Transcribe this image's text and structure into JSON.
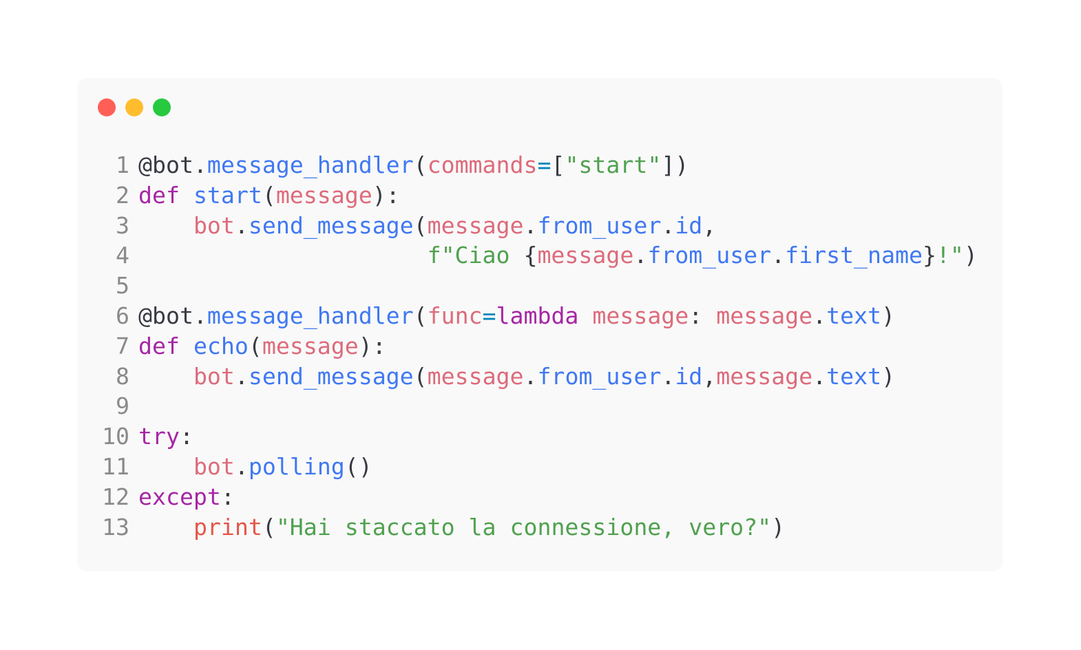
{
  "window": {
    "dots": [
      {
        "name": "close-dot",
        "color": "#ff5f56"
      },
      {
        "name": "minimize-dot",
        "color": "#ffbd2e"
      },
      {
        "name": "maximize-dot",
        "color": "#27c93f"
      }
    ]
  },
  "colors": {
    "background": "#f9f9f9",
    "keyword": "#a626a4",
    "function": "#4078f2",
    "variable": "#dd6b7b",
    "builtin": "#e45649",
    "string": "#50a14f",
    "operator": "#0184bc",
    "plain": "#383a42",
    "line_number": "#8a8a8a"
  },
  "code": {
    "language": "python",
    "lines": [
      {
        "number": "1",
        "tokens": [
          {
            "t": "plain",
            "v": "@bot."
          },
          {
            "t": "func",
            "v": "message_handler"
          },
          {
            "t": "plain",
            "v": "("
          },
          {
            "t": "var",
            "v": "commands"
          },
          {
            "t": "op",
            "v": "="
          },
          {
            "t": "plain",
            "v": "["
          },
          {
            "t": "string",
            "v": "\"start\""
          },
          {
            "t": "plain",
            "v": "])"
          }
        ]
      },
      {
        "number": "2",
        "tokens": [
          {
            "t": "keyword",
            "v": "def"
          },
          {
            "t": "plain",
            "v": " "
          },
          {
            "t": "func",
            "v": "start"
          },
          {
            "t": "plain",
            "v": "("
          },
          {
            "t": "var",
            "v": "message"
          },
          {
            "t": "plain",
            "v": "):"
          }
        ]
      },
      {
        "number": "3",
        "tokens": [
          {
            "t": "plain",
            "v": "    "
          },
          {
            "t": "var",
            "v": "bot"
          },
          {
            "t": "plain",
            "v": "."
          },
          {
            "t": "func",
            "v": "send_message"
          },
          {
            "t": "plain",
            "v": "("
          },
          {
            "t": "var",
            "v": "message"
          },
          {
            "t": "plain",
            "v": "."
          },
          {
            "t": "func",
            "v": "from_user"
          },
          {
            "t": "plain",
            "v": "."
          },
          {
            "t": "func",
            "v": "id"
          },
          {
            "t": "plain",
            "v": ","
          }
        ]
      },
      {
        "number": "4",
        "tokens": [
          {
            "t": "plain",
            "v": "                     "
          },
          {
            "t": "string",
            "v": "f\"Ciao "
          },
          {
            "t": "plain",
            "v": "{"
          },
          {
            "t": "var",
            "v": "message"
          },
          {
            "t": "plain",
            "v": "."
          },
          {
            "t": "func",
            "v": "from_user"
          },
          {
            "t": "plain",
            "v": "."
          },
          {
            "t": "func",
            "v": "first_name"
          },
          {
            "t": "plain",
            "v": "}"
          },
          {
            "t": "string",
            "v": "!\""
          },
          {
            "t": "plain",
            "v": ")"
          }
        ]
      },
      {
        "number": "5",
        "tokens": []
      },
      {
        "number": "6",
        "tokens": [
          {
            "t": "plain",
            "v": "@bot."
          },
          {
            "t": "func",
            "v": "message_handler"
          },
          {
            "t": "plain",
            "v": "("
          },
          {
            "t": "var",
            "v": "func"
          },
          {
            "t": "op",
            "v": "="
          },
          {
            "t": "keyword",
            "v": "lambda"
          },
          {
            "t": "plain",
            "v": " "
          },
          {
            "t": "var",
            "v": "message"
          },
          {
            "t": "plain",
            "v": ": "
          },
          {
            "t": "var",
            "v": "message"
          },
          {
            "t": "plain",
            "v": "."
          },
          {
            "t": "func",
            "v": "text"
          },
          {
            "t": "plain",
            "v": ")"
          }
        ]
      },
      {
        "number": "7",
        "tokens": [
          {
            "t": "keyword",
            "v": "def"
          },
          {
            "t": "plain",
            "v": " "
          },
          {
            "t": "func",
            "v": "echo"
          },
          {
            "t": "plain",
            "v": "("
          },
          {
            "t": "var",
            "v": "message"
          },
          {
            "t": "plain",
            "v": "):"
          }
        ]
      },
      {
        "number": "8",
        "tokens": [
          {
            "t": "plain",
            "v": "    "
          },
          {
            "t": "var",
            "v": "bot"
          },
          {
            "t": "plain",
            "v": "."
          },
          {
            "t": "func",
            "v": "send_message"
          },
          {
            "t": "plain",
            "v": "("
          },
          {
            "t": "var",
            "v": "message"
          },
          {
            "t": "plain",
            "v": "."
          },
          {
            "t": "func",
            "v": "from_user"
          },
          {
            "t": "plain",
            "v": "."
          },
          {
            "t": "func",
            "v": "id"
          },
          {
            "t": "plain",
            "v": ","
          },
          {
            "t": "var",
            "v": "message"
          },
          {
            "t": "plain",
            "v": "."
          },
          {
            "t": "func",
            "v": "text"
          },
          {
            "t": "plain",
            "v": ")"
          }
        ]
      },
      {
        "number": "9",
        "tokens": []
      },
      {
        "number": "10",
        "tokens": [
          {
            "t": "keyword",
            "v": "try"
          },
          {
            "t": "plain",
            "v": ":"
          }
        ]
      },
      {
        "number": "11",
        "tokens": [
          {
            "t": "plain",
            "v": "    "
          },
          {
            "t": "var",
            "v": "bot"
          },
          {
            "t": "plain",
            "v": "."
          },
          {
            "t": "func",
            "v": "polling"
          },
          {
            "t": "plain",
            "v": "()"
          }
        ]
      },
      {
        "number": "12",
        "tokens": [
          {
            "t": "keyword",
            "v": "except"
          },
          {
            "t": "plain",
            "v": ":"
          }
        ]
      },
      {
        "number": "13",
        "tokens": [
          {
            "t": "plain",
            "v": "    "
          },
          {
            "t": "builtin",
            "v": "print"
          },
          {
            "t": "plain",
            "v": "("
          },
          {
            "t": "string",
            "v": "\"Hai staccato la connessione, vero?\""
          },
          {
            "t": "plain",
            "v": ")"
          }
        ]
      }
    ]
  }
}
